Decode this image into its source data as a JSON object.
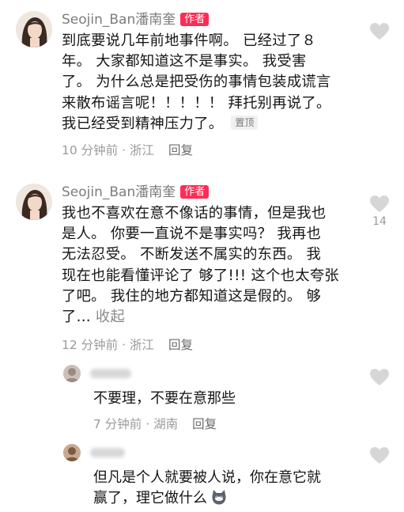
{
  "comments": [
    {
      "username": "Seojin_Ban潘南奎",
      "badge": "作者",
      "lines": [
        "到底要说几年前地事件啊。 已经过了８",
        "年。 大家都知道这不是事实。 我受害",
        "了。 为什么总是把受伤的事情包装成谎言",
        "来散布谣言呢！！！！！ 拜托别再说了。",
        "我已经受到精神压力了。"
      ],
      "pin_label": "置顶",
      "time": "10 分钟前 · 浙江",
      "reply_label": "回复",
      "like_count": ""
    },
    {
      "username": "Seojin_Ban潘南奎",
      "badge": "作者",
      "lines": [
        "我也不喜欢在意不像话的事情，但是我也",
        "是人。 你要一直说不是事实吗？ 我再也",
        "无法忍受。 不断发送不属实的东西。 我",
        "现在也能看懂评论了 够了!!! 这个也太夸张",
        "了吧。 我住的地方都知道这是假的。 够",
        "了..."
      ],
      "collapse_label": "收起",
      "time": "12 分钟前 · 浙江",
      "reply_label": "回复",
      "like_count": "14"
    }
  ],
  "replies": [
    {
      "username": "",
      "text": "不要理，不要在意那些",
      "time": "7 分钟前 · 湖南",
      "reply_label": "回复"
    },
    {
      "username": "",
      "text": "但凡是个人就要被人说，你在意它就",
      "text_line2": "赢了，理它做什么",
      "emoji": "cat-emoji"
    }
  ],
  "colors": {
    "accent": "#fe2c55",
    "text": "#161616",
    "secondary": "#9a9a9a",
    "icon": "#d6d6d6"
  }
}
